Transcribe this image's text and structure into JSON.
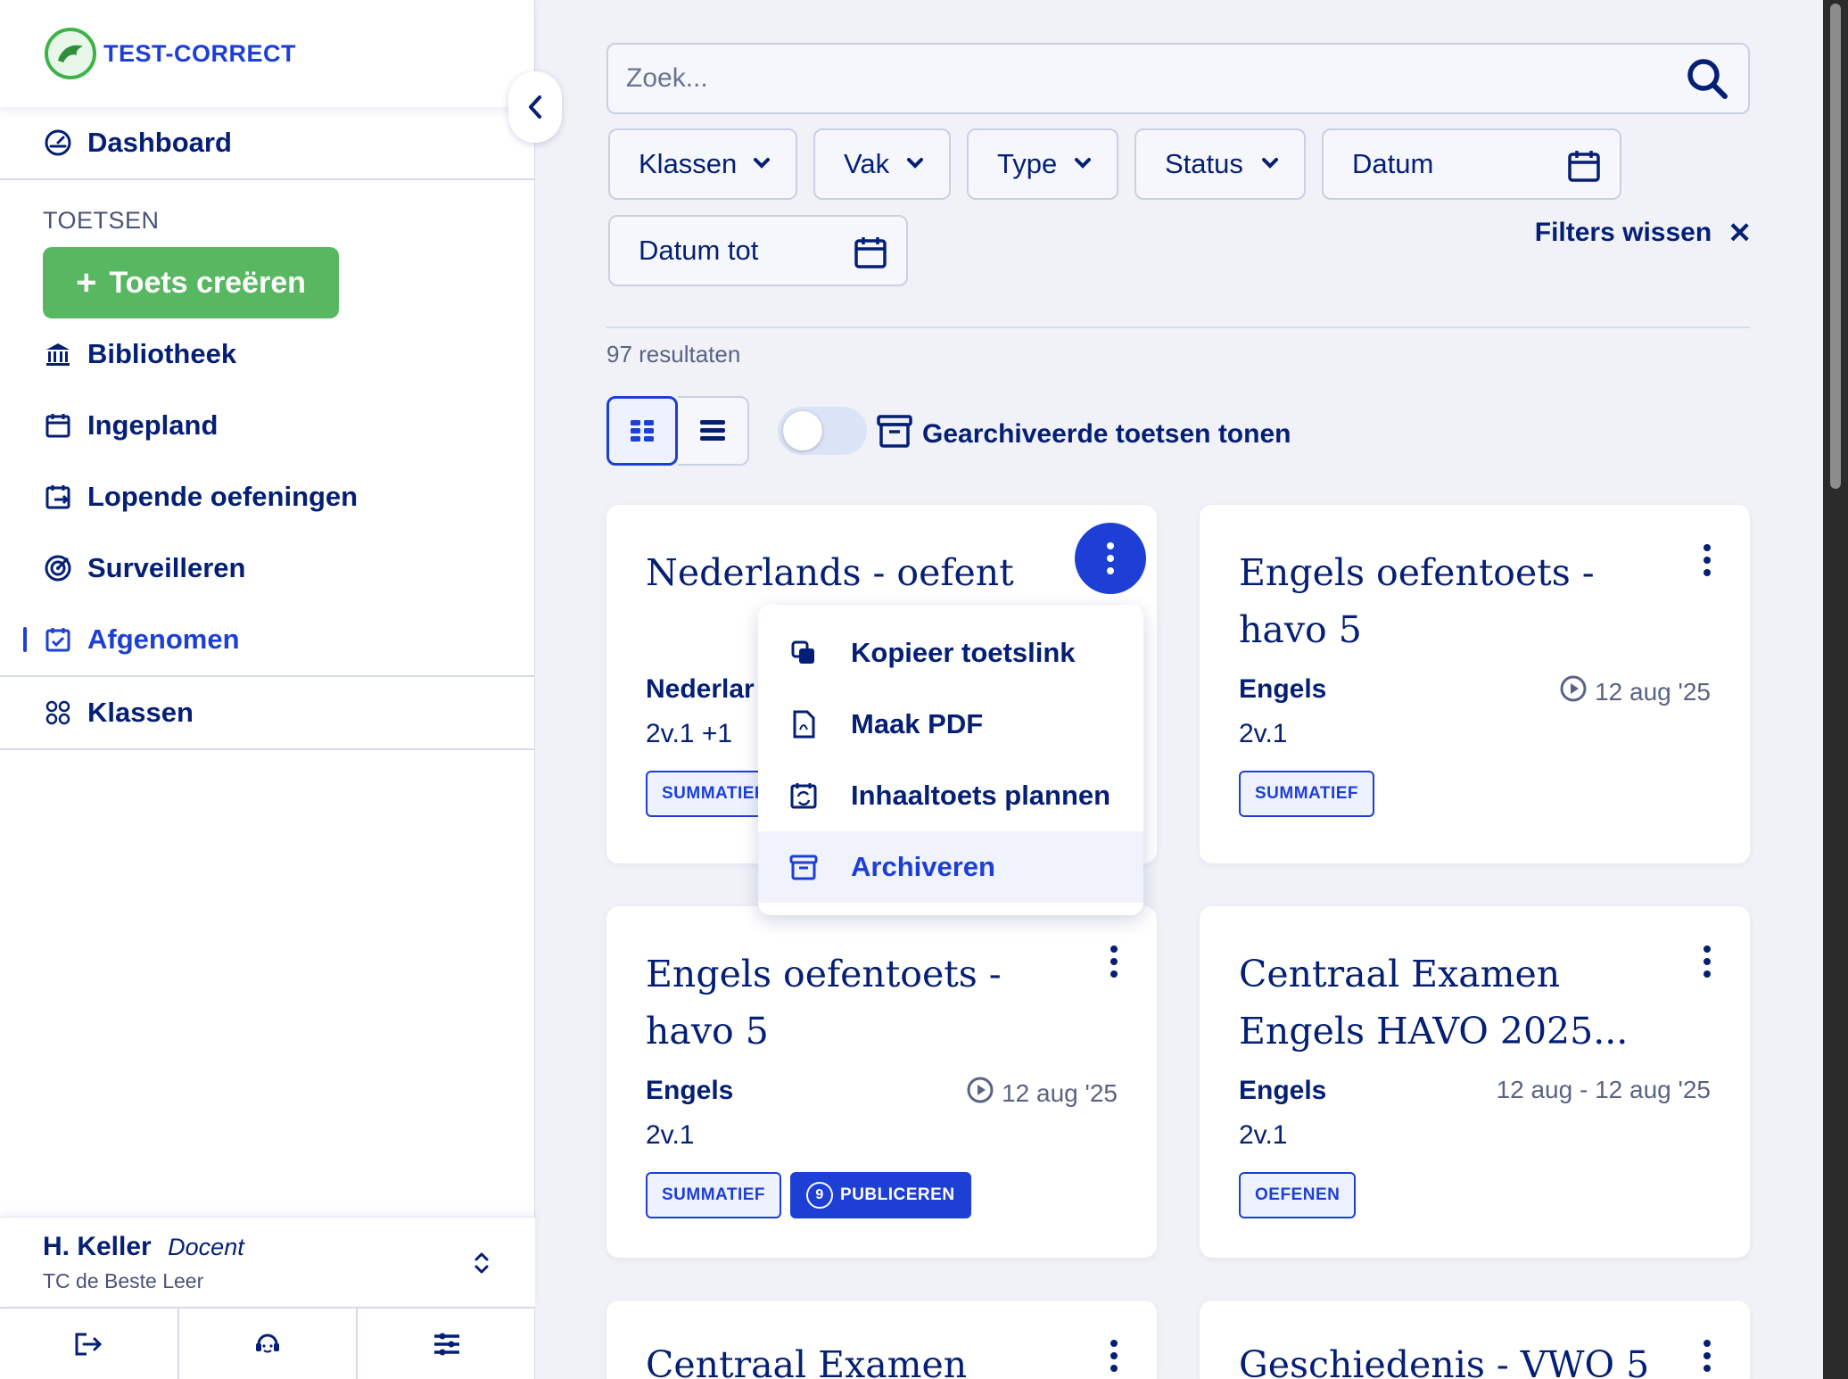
{
  "brand": {
    "logo_text": "TEST-CORRECT"
  },
  "sidebar": {
    "dashboard": "Dashboard",
    "section_label": "TOETSEN",
    "create_label": "Toets creëren",
    "items": [
      {
        "label": "Bibliotheek",
        "icon": "library-icon"
      },
      {
        "label": "Ingepland",
        "icon": "calendar-icon"
      },
      {
        "label": "Lopende oefeningen",
        "icon": "calendar-arrow-icon"
      },
      {
        "label": "Surveilleren",
        "icon": "target-icon"
      },
      {
        "label": "Afgenomen",
        "icon": "calendar-check-icon",
        "active": true
      }
    ],
    "klassen": "Klassen",
    "user": {
      "name": "H. Keller",
      "role": "Docent",
      "school": "TC de Beste Leer"
    }
  },
  "search": {
    "placeholder": "Zoek..."
  },
  "filters": {
    "klassen": "Klassen",
    "vak": "Vak",
    "type": "Type",
    "status": "Status",
    "datum": "Datum",
    "datum_tot": "Datum tot",
    "clear": "Filters wissen"
  },
  "results": {
    "count_label": "97 resultaten"
  },
  "view": {
    "archived_label": "Gearchiveerde toetsen tonen"
  },
  "cards": [
    {
      "title": "Nederlands - oefent",
      "subject": "Nederlar",
      "classes": "2v.1 +1",
      "badges": [
        "SUMMATIEF"
      ]
    },
    {
      "title": "Engels oefentoets - havo 5",
      "subject": "Engels",
      "date": "12 aug '25",
      "classes": "2v.1",
      "badges": [
        "SUMMATIEF"
      ]
    },
    {
      "title": "Engels oefentoets - havo 5",
      "subject": "Engels",
      "date": "12 aug '25",
      "classes": "2v.1",
      "badges": [
        "SUMMATIEF",
        "PUBLICEREN"
      ],
      "publish_count": "9"
    },
    {
      "title": "Centraal Examen Engels HAVO 2025...",
      "subject": "Engels",
      "date": "12 aug - 12 aug '25",
      "classes": "2v.1",
      "badges": [
        "OEFENEN"
      ]
    },
    {
      "title": "Centraal Examen"
    },
    {
      "title": "Geschiedenis - VWO 5"
    }
  ],
  "context_menu": {
    "items": [
      "Kopieer toetslink",
      "Maak PDF",
      "Inhaaltoets plannen",
      "Archiveren"
    ]
  },
  "colors": {
    "primary": "#1d3fd6",
    "navy": "#041f74",
    "green": "#58b761",
    "background": "#f0f2f8"
  }
}
